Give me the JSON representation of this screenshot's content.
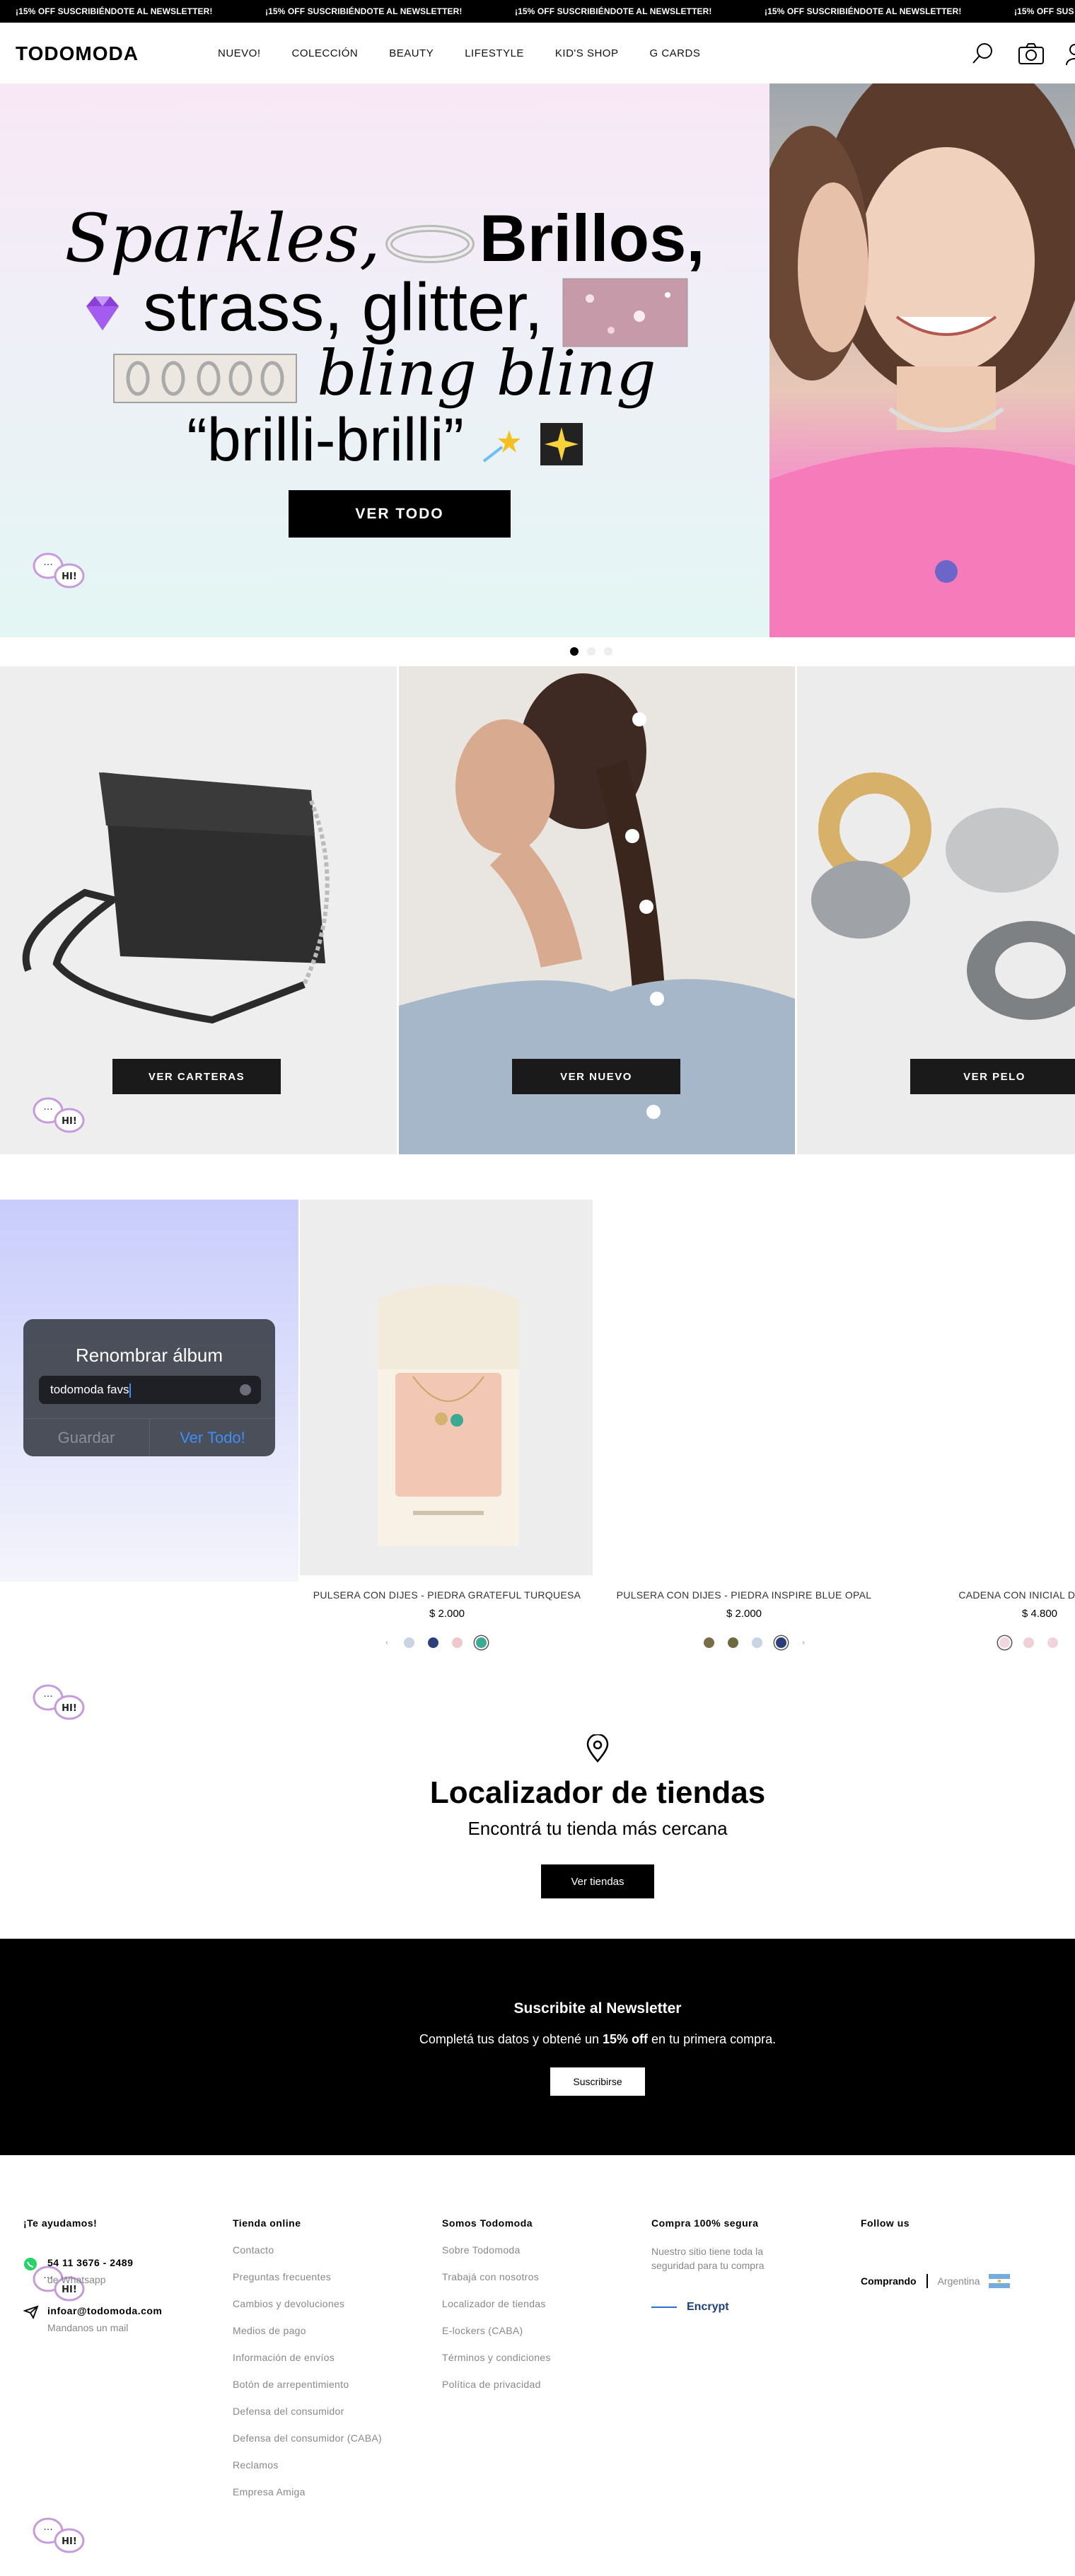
{
  "promo": {
    "items": [
      "¡15% OFF SUSCRIBIÉNDOTE AL NEWSLETTER!",
      "¡15% OFF SUSCRIBIÉNDOTE AL NEWSLETTER!",
      "¡15% OFF SUSCRIBIÉNDOTE AL NEWSLETTER!",
      "¡15% OFF SUSCRIBIÉNDOTE AL NEWSLETTER!",
      "¡15% OFF SUS"
    ]
  },
  "header": {
    "logo": "TODOMODA",
    "nav": [
      "NUEVO!",
      "COLECCIÓN",
      "BEAUTY",
      "LIFESTYLE",
      "KID'S SHOP",
      "G CARDS"
    ],
    "icons": [
      "search-icon",
      "camera-icon",
      "user-icon"
    ]
  },
  "hero": {
    "line1_a": "Sparkles,",
    "line1_b": "Brillos,",
    "line2": "strass, glitter,",
    "line3": "bling bling",
    "line4": "“brilli-brilli”",
    "button": "VER TODO",
    "slides_active": 1,
    "slides_total": 3
  },
  "tiles": [
    {
      "button": "VER CARTERAS"
    },
    {
      "button": "VER NUEVO"
    },
    {
      "button": "VER PELO"
    }
  ],
  "album_dialog": {
    "title": "Renombrar álbum",
    "input_value": "todomoda favs",
    "save": "Guardar",
    "view_all": "Ver Todo!"
  },
  "products": [
    {
      "name": "PULSERA CON DIJES - PIEDRA GRATEFUL TURQUESA",
      "price": "$ 2.000",
      "swatches": [
        "#c9d3e6",
        "#2c3f7a",
        "#f0c7cc",
        "#3ba993"
      ],
      "selected": 3
    },
    {
      "name": "PULSERA CON DIJES - PIEDRA INSPIRE BLUE OPAL",
      "price": "$ 2.000",
      "swatches": [
        "#786c49",
        "#6e6a40",
        "#c9d3e6",
        "#2c3f7a"
      ],
      "selected": 3
    },
    {
      "name": "CADENA CON INICIAL DE ACERO",
      "price": "$ 4.800",
      "swatches": [
        "#f3d6dd",
        "#f0cfd7",
        "#f1d4db"
      ],
      "selected": 0
    }
  ],
  "chat": {
    "label": "HI!"
  },
  "locator": {
    "title": "Localizador de tiendas",
    "subtitle": "Encontrá tu tienda más cercana",
    "button": "Ver tiendas"
  },
  "newsletter": {
    "title": "Suscribite al Newsletter",
    "text_before": "Completá tus datos y obtené un ",
    "text_bold": "15% off",
    "text_after": " en tu primera compra.",
    "button": "Suscribirse"
  },
  "footer": {
    "help": {
      "title": "¡Te ayudamos!",
      "phone": "54 11 3676 - 2489",
      "phone_sub": "de Whatsapp",
      "email": "infoar@todomoda.com",
      "email_sub": "Mandanos un mail"
    },
    "online": {
      "title": "Tienda online",
      "links": [
        "Contacto",
        "Preguntas frecuentes",
        "Cambios y devoluciones",
        "Medios de pago",
        "Información de envíos",
        "Botón de arrepentimiento",
        "Defensa del consumidor",
        "Defensa del consumidor (CABA)",
        "Reclamos",
        "Empresa Amiga"
      ]
    },
    "about": {
      "title": "Somos Todomoda",
      "links": [
        "Sobre Todomoda",
        "Trabajá con nosotros",
        "Localizador de tiendas",
        "E-lockers (CABA)",
        "Términos y condiciones",
        "Política de privacidad"
      ]
    },
    "secure": {
      "title": "Compra 100% segura",
      "text": "Nuestro sitio tiene toda la seguridad para tu compra",
      "badge": "Encrypt"
    },
    "follow": {
      "title": "Follow us",
      "country_label": "Comprando",
      "country": "Argentina"
    }
  }
}
